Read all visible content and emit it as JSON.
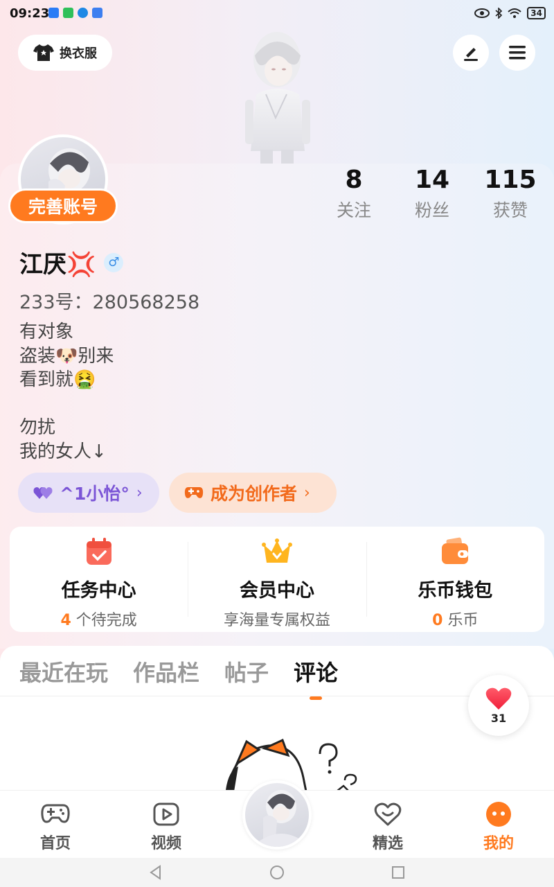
{
  "status_bar": {
    "time": "09:23",
    "battery": "34"
  },
  "header": {
    "outfit_label": "换衣服"
  },
  "profile": {
    "complete_label": "完善账号",
    "name": "江厌💢",
    "gender_symbol": "♂",
    "uid": "233号：280568258",
    "bio_lines": [
      "有对象",
      "盗装🐶别来",
      "看到就🤮",
      "",
      "勿扰",
      "我的女人↓"
    ],
    "stats": [
      {
        "value": "8",
        "label": "关注"
      },
      {
        "value": "14",
        "label": "粉丝"
      },
      {
        "value": "115",
        "label": "获赞"
      }
    ],
    "partner_chip": "^1小怡°",
    "creator_chip": "成为创作者"
  },
  "services": [
    {
      "title": "任务中心",
      "sub_highlight": "4",
      "sub": " 个待完成"
    },
    {
      "title": "会员中心",
      "sub_highlight": "",
      "sub": "享海量专属权益"
    },
    {
      "title": "乐币钱包",
      "sub_highlight": "0",
      "sub": " 乐币"
    }
  ],
  "tabs": [
    {
      "label": "最近在玩",
      "active": false
    },
    {
      "label": "作品栏",
      "active": false
    },
    {
      "label": "帖子",
      "active": false
    },
    {
      "label": "评论",
      "active": true
    }
  ],
  "like": {
    "count": "31"
  },
  "bottom_nav": [
    {
      "label": "首页",
      "icon": "gamepad-icon"
    },
    {
      "label": "视频",
      "icon": "video-icon"
    },
    {
      "label": "精选",
      "icon": "heart-icon"
    },
    {
      "label": "我的",
      "icon": "profile-icon",
      "active": true
    }
  ],
  "colors": {
    "accent": "#ff7a1f",
    "partner": "#7b55d6"
  }
}
